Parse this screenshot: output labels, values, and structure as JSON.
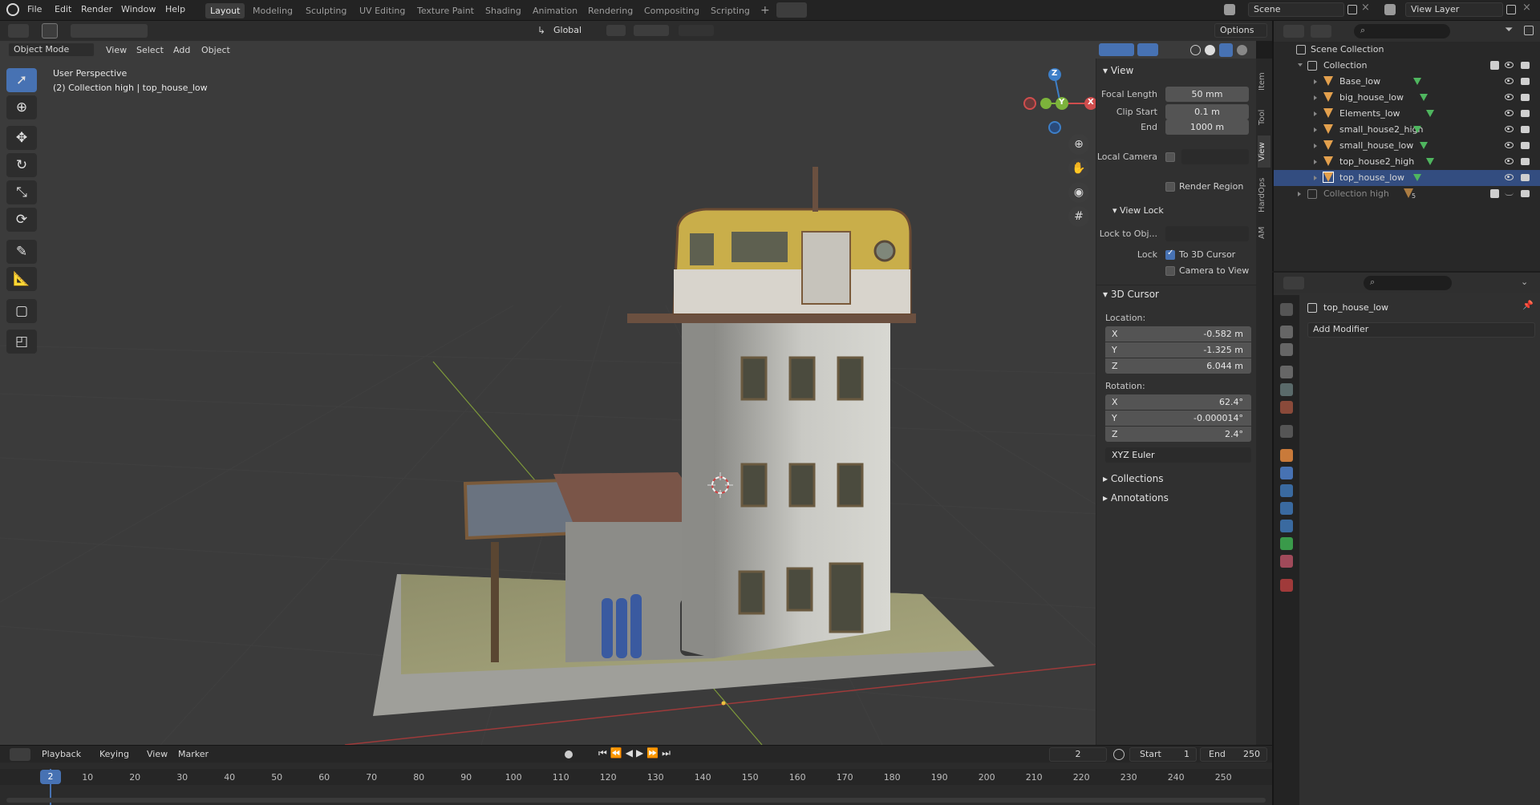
{
  "topbar": {
    "menus": [
      "File",
      "Edit",
      "Render",
      "Window",
      "Help"
    ],
    "workspaces": [
      "Layout",
      "Modeling",
      "Sculpting",
      "UV Editing",
      "Texture Paint",
      "Shading",
      "Animation",
      "Rendering",
      "Compositing",
      "Scripting"
    ],
    "active_workspace": "Layout",
    "add_tab": "+",
    "scene": "Scene",
    "view_layer": "View Layer"
  },
  "viewport_header": {
    "mode": "Object Mode",
    "menus": [
      "View",
      "Select",
      "Add",
      "Object"
    ],
    "orientation": "Global",
    "options": "Options"
  },
  "overlay": {
    "perspective": "User Perspective",
    "collection_info": "(2) Collection high | top_house_low"
  },
  "gizmo": {
    "x": "X",
    "y": "Y",
    "z": "Z"
  },
  "npanel": {
    "view_section": "View",
    "focal_length_label": "Focal Length",
    "focal_length": "50 mm",
    "clip_start_label": "Clip Start",
    "clip_start": "0.1 m",
    "end_label": "End",
    "end": "1000 m",
    "local_camera_label": "Local Camera",
    "render_region": "Render Region",
    "view_lock_section": "View Lock",
    "lock_to_obj_label": "Lock to Obj...",
    "lock_label": "Lock",
    "to_3d_cursor": "To 3D Cursor",
    "camera_to_view": "Camera to View",
    "cursor_section": "3D Cursor",
    "location_label": "Location:",
    "loc_x": "-0.582 m",
    "loc_y": "-1.325 m",
    "loc_z": "6.044 m",
    "rotation_label": "Rotation:",
    "rot_x": "62.4°",
    "rot_y": "-0.000014°",
    "rot_z": "2.4°",
    "rotation_mode": "XYZ Euler",
    "collections_section": "Collections",
    "annotations_section": "Annotations",
    "axis_x": "X",
    "axis_y": "Y",
    "axis_z": "Z"
  },
  "side_tabs": [
    "Item",
    "Tool",
    "View",
    "HardOps",
    "AM"
  ],
  "active_side_tab": "View",
  "outliner": {
    "scene_collection": "Scene Collection",
    "collection": "Collection",
    "objects": [
      "Base_low",
      "big_house_low",
      "Elements_low",
      "small_house2_high",
      "small_house_low",
      "top_house2_high",
      "top_house_low"
    ],
    "collection_high": "Collection high",
    "collection_high_count": "5"
  },
  "properties": {
    "object_name": "top_house_low",
    "add_modifier": "Add Modifier"
  },
  "timeline": {
    "menus": [
      "Playback",
      "Keying",
      "View",
      "Marker"
    ],
    "current_frame": "2",
    "start_label": "Start",
    "start": "1",
    "end_label": "End",
    "end": "250",
    "ticks": [
      "10",
      "20",
      "30",
      "40",
      "50",
      "60",
      "70",
      "80",
      "90",
      "100",
      "110",
      "120",
      "130",
      "140",
      "150",
      "160",
      "170",
      "180",
      "190",
      "200",
      "210",
      "220",
      "230",
      "240",
      "250"
    ],
    "playhead": "2"
  },
  "colors": {
    "accent": "#4772b3",
    "grid_x": "#9e3a3a",
    "grid_y": "#7e9a3a",
    "mesh_icon": "#e3a04d"
  }
}
